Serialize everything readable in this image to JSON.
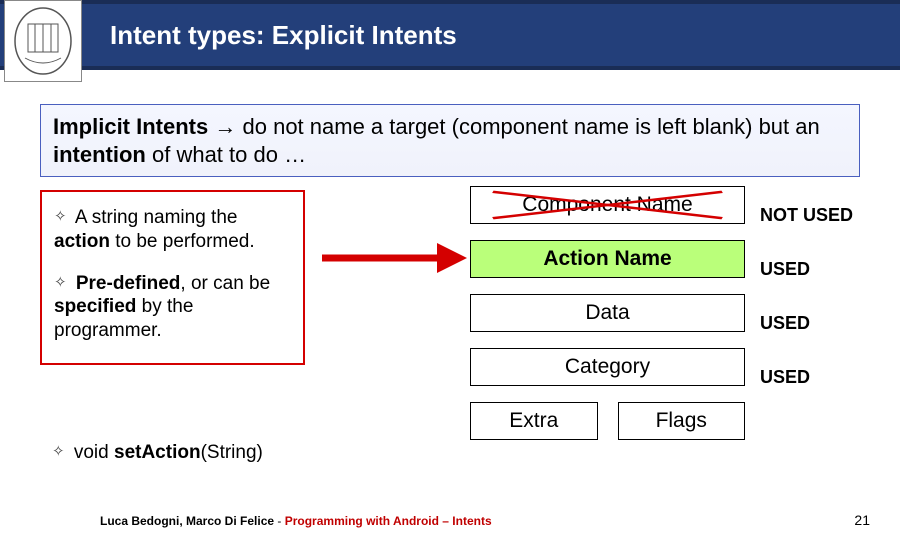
{
  "title": "Intent types: Explicit Intents",
  "intro": {
    "lead": "Implicit Intents",
    "arrow": "→",
    "part1": "do not name a target (component name is left blank) but an ",
    "bold": "intention",
    "part2": " of what to do …"
  },
  "bullets": {
    "b1_pre": "A string naming the ",
    "b1_bold": "action",
    "b1_post": " to be performed.",
    "b2_bold1": "Pre-defined",
    "b2_mid": ", or can be ",
    "b2_bold2": "specified",
    "b2_post": " by the programmer."
  },
  "bullet3_pre": "void ",
  "bullet3_bold": "setAction",
  "bullet3_post": "(String)",
  "blocks": {
    "component": "Component Name",
    "action": "Action Name",
    "data": "Data",
    "category": "Category",
    "extra": "Extra",
    "flags": "Flags"
  },
  "labels": {
    "notused": "NOT USED",
    "used1": "USED",
    "used2": "USED",
    "used3": "USED"
  },
  "footer": {
    "authors": "Luca Bedogni, Marco Di Felice",
    "sep": " - ",
    "course": "Programming with Android – Intents"
  },
  "page": "21"
}
